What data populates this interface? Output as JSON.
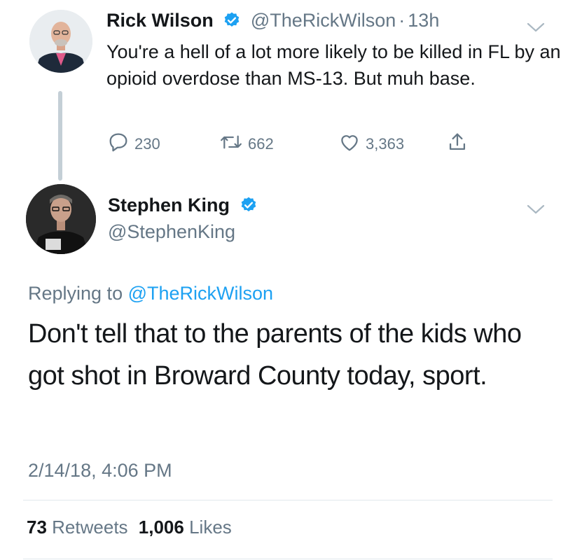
{
  "tweet1": {
    "name": "Rick Wilson",
    "handle": "@TheRickWilson",
    "separator": "·",
    "time": "13h",
    "text": "You're a hell of a lot more likely to be killed in FL by an opioid overdose than MS-13. But muh base.",
    "replies": "230",
    "retweets": "662",
    "likes": "3,363"
  },
  "tweet2": {
    "name": "Stephen King",
    "handle": "@StephenKing",
    "replying_label": "Replying to",
    "replying_handle": "@TheRickWilson",
    "text": "Don't tell that to the parents of the kids who got shot in Broward County today, sport.",
    "timestamp": "2/14/18, 4:06 PM",
    "retweet_count": "73",
    "retweet_label": "Retweets",
    "like_count": "1,006",
    "like_label": "Likes"
  },
  "colors": {
    "text": "#14171a",
    "secondary": "#657786",
    "link": "#1da1f2",
    "verified": "#1da1f2",
    "divider": "#e1e8ed"
  },
  "icons": [
    "reply-icon",
    "retweet-icon",
    "like-icon",
    "share-icon",
    "verified-icon",
    "chevron-down-icon"
  ]
}
